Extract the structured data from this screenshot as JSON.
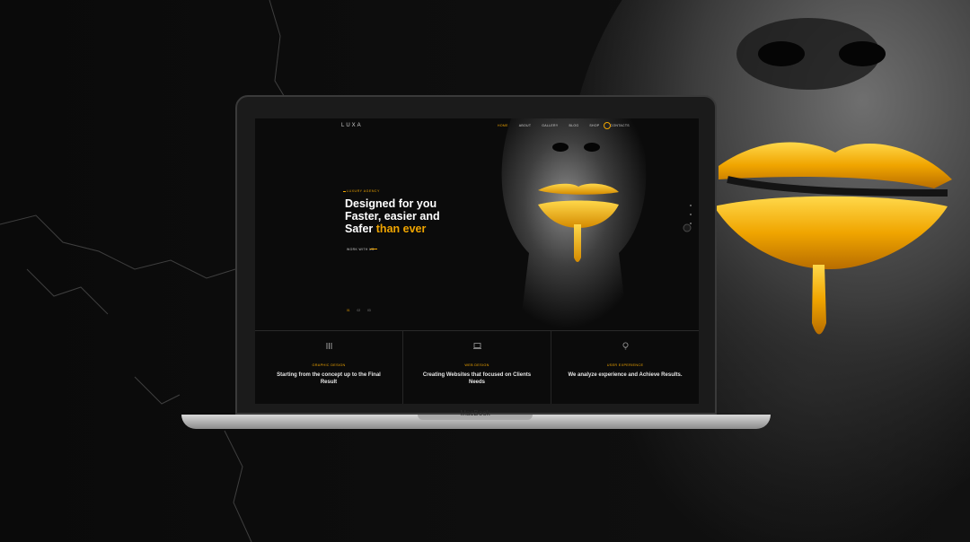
{
  "device": {
    "label": "MacBook"
  },
  "site": {
    "logo": "LUXA",
    "nav": [
      {
        "label": "HOME",
        "active": true
      },
      {
        "label": "ABOUT",
        "active": false
      },
      {
        "label": "GALLERY",
        "active": false
      },
      {
        "label": "BLOG",
        "active": false
      },
      {
        "label": "SHOP",
        "active": false
      },
      {
        "label": "CONTACTS",
        "active": false
      }
    ],
    "hero": {
      "kicker": "LUXURY AGENCY",
      "headline_line1": "Designed for you",
      "headline_line2": "Faster, easier and",
      "headline_line3_a": "Safer",
      "headline_line3_b": "than ever",
      "cta": "WORK WITH US"
    },
    "slider": [
      "01",
      "02",
      "03"
    ],
    "features": [
      {
        "icon": "brush-tools-icon",
        "tag": "GRAPHIC DESIGN",
        "text": "Starting from the concept up to the Final Result"
      },
      {
        "icon": "laptop-icon",
        "tag": "WEB DESIGN",
        "text": "Creating Websites that focused on Clients Needs"
      },
      {
        "icon": "lightbulb-icon",
        "tag": "USER EXPERIENCE",
        "text": "We analyze experience and Achieve Results."
      }
    ]
  },
  "colors": {
    "accent": "#f0a500",
    "background": "#070707",
    "text": "#ffffff"
  }
}
